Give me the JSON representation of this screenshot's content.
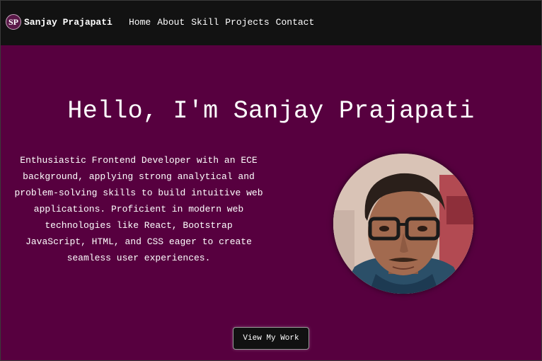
{
  "navbar": {
    "logo_initials": "SP",
    "brand_name": "Sanjay Prajapati",
    "links": [
      "Home",
      "About",
      "Skill",
      "Projects",
      "Contact"
    ]
  },
  "hero": {
    "title": "Hello, I'm Sanjay Prajapati",
    "intro": "Enthusiastic Frontend Developer with an ECE background, applying strong analytical and problem-solving skills to build intuitive web applications. Proficient in modern web technologies like React, Bootstrap JavaScript, HTML, and CSS eager to create seamless user experiences.",
    "cta_label": "View My Work"
  },
  "colors": {
    "navbar_bg": "#121212",
    "hero_bg": "#57003f",
    "text": "#ffffff",
    "button_bg": "#111111"
  }
}
